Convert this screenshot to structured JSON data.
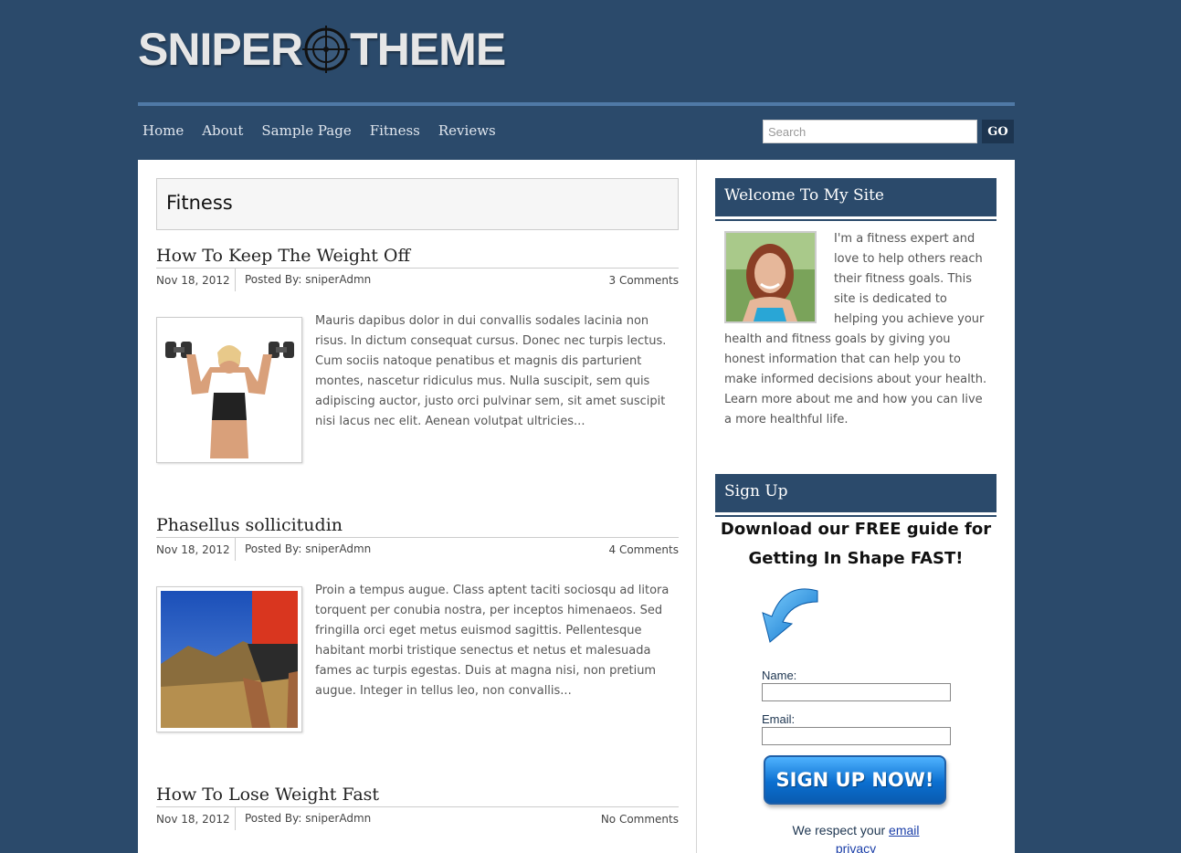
{
  "header": {
    "logo_left": "SNIPER",
    "logo_right": "THEME",
    "nav": [
      "Home",
      "About",
      "Sample Page",
      "Fitness",
      "Reviews"
    ],
    "search_placeholder": "Search",
    "search_button": "GO"
  },
  "main": {
    "category_title": "Fitness",
    "posts": [
      {
        "title": "How To Keep The Weight Off",
        "date": "Nov 18, 2012",
        "author": "Posted By: sniperAdmn",
        "comments": "3 Comments",
        "excerpt": "Mauris dapibus dolor in dui convallis sodales lacinia non risus. In dictum consequat cursus. Donec nec turpis lectus. Cum sociis natoque penatibus et magnis dis parturient montes, nascetur ridiculus mus. Nulla suscipit, sem quis adipiscing auctor, justo orci pulvinar sem, sit amet suscipit nisi lacus nec elit. Aenean volutpat ultricies..."
      },
      {
        "title": "Phasellus sollicitudin",
        "date": "Nov 18, 2012",
        "author": "Posted By: sniperAdmn",
        "comments": "4 Comments",
        "excerpt": "Proin a tempus augue. Class aptent taciti sociosqu ad litora torquent per conubia nostra, per inceptos himenaeos. Sed fringilla orci eget metus euismod sagittis. Pellentesque habitant morbi tristique senectus et netus et malesuada fames ac turpis egestas. Duis at magna nisi, non pretium augue. Integer in tellus leo, non convallis..."
      },
      {
        "title": "How To Lose Weight Fast",
        "date": "Nov 18, 2012",
        "author": "Posted By: sniperAdmn",
        "comments": "No Comments",
        "excerpt": ""
      }
    ]
  },
  "sidebar": {
    "welcome_title": "Welcome To My Site",
    "welcome_text": "I'm a fitness expert and love to help others reach their fitness goals. This site is dedicated to helping you achieve your health and fitness goals by giving you honest information that can help you to make informed decisions about your health. Learn more about me and how you can live a more healthful life.",
    "signup_title": "Sign Up",
    "signup_line1": "Download our FREE guide for",
    "signup_line2": "Getting In Shape FAST!",
    "name_label": "Name:",
    "email_label": "Email:",
    "signup_button": "SIGN UP NOW!",
    "respect_text": "We respect your ",
    "respect_link": "email",
    "respect_more": "privacy"
  },
  "colors": {
    "background": "#2b4a6b",
    "accent": "#4f79a6",
    "button": "#0b6fd0"
  }
}
